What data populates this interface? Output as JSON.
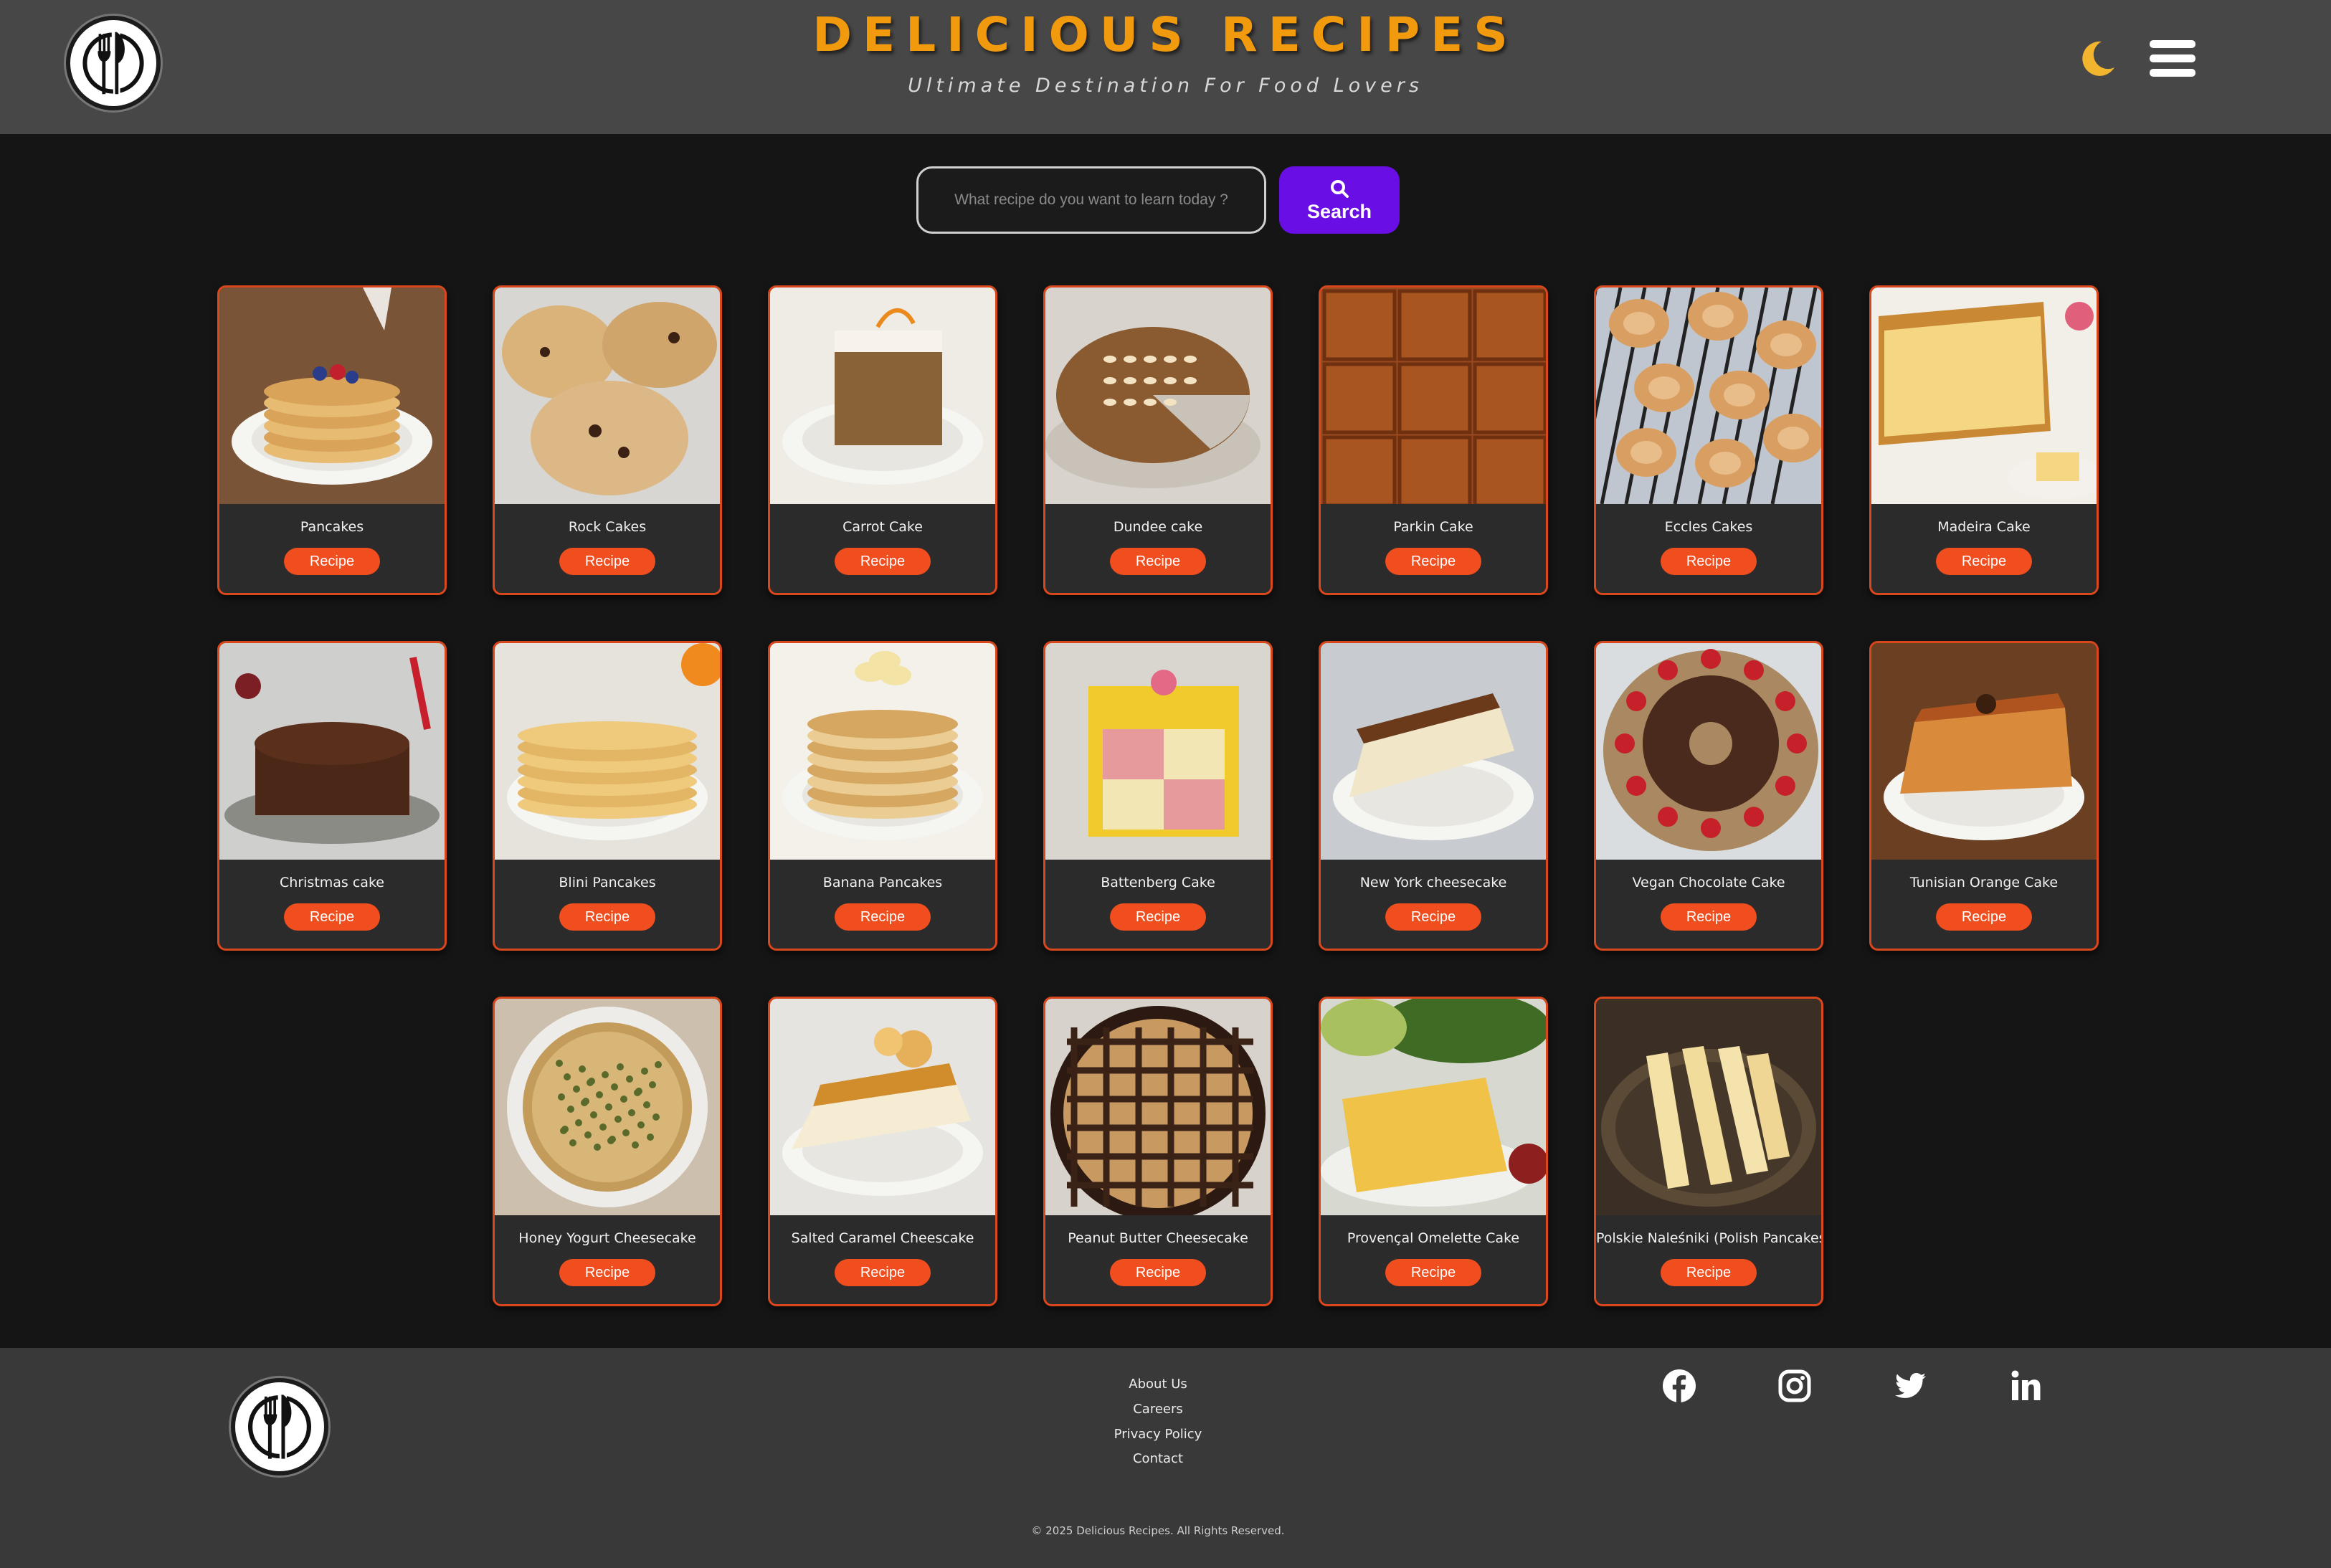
{
  "header": {
    "title": "DELICIOUS RECIPES",
    "subtitle": "Ultimate Destination For Food Lovers",
    "theme_toggle_icon": "moon-icon",
    "menu_icon": "hamburger-menu-icon",
    "logo_icon": "fork-knife-plate-logo"
  },
  "search": {
    "placeholder": "What recipe do you want to learn today ?",
    "value": "",
    "button_label": "Search",
    "button_icon": "magnifier-icon"
  },
  "colors": {
    "title": "#f29a0e",
    "search_button": "#6a0ee6",
    "recipe_button": "#f04e1e",
    "card_border": "#d9471c",
    "moon": "#f4b52e"
  },
  "recipes": [
    {
      "name": "Pancakes",
      "button": "Recipe"
    },
    {
      "name": "Rock Cakes",
      "button": "Recipe"
    },
    {
      "name": "Carrot Cake",
      "button": "Recipe"
    },
    {
      "name": "Dundee cake",
      "button": "Recipe"
    },
    {
      "name": "Parkin Cake",
      "button": "Recipe"
    },
    {
      "name": "Eccles Cakes",
      "button": "Recipe"
    },
    {
      "name": "Madeira Cake",
      "button": "Recipe"
    },
    {
      "name": "Christmas cake",
      "button": "Recipe"
    },
    {
      "name": "Blini Pancakes",
      "button": "Recipe"
    },
    {
      "name": "Banana Pancakes",
      "button": "Recipe"
    },
    {
      "name": "Battenberg Cake",
      "button": "Recipe"
    },
    {
      "name": "New York cheesecake",
      "button": "Recipe"
    },
    {
      "name": "Vegan Chocolate Cake",
      "button": "Recipe"
    },
    {
      "name": "Tunisian Orange Cake",
      "button": "Recipe"
    },
    {
      "name": "Honey Yogurt Cheesecake",
      "button": "Recipe"
    },
    {
      "name": "Salted Caramel Cheescake",
      "button": "Recipe"
    },
    {
      "name": "Peanut Butter Cheesecake",
      "button": "Recipe"
    },
    {
      "name": "Provençal Omelette Cake",
      "button": "Recipe"
    },
    {
      "name": "Polskie Naleśniki (Polish Pancakes)",
      "button": "Recipe"
    }
  ],
  "footer": {
    "links": [
      "About Us",
      "Careers",
      "Privacy Policy",
      "Contact"
    ],
    "social": [
      "facebook-icon",
      "instagram-icon",
      "twitter-icon",
      "linkedin-icon"
    ],
    "copyright": "© 2025 Delicious Recipes. All Rights Reserved."
  }
}
